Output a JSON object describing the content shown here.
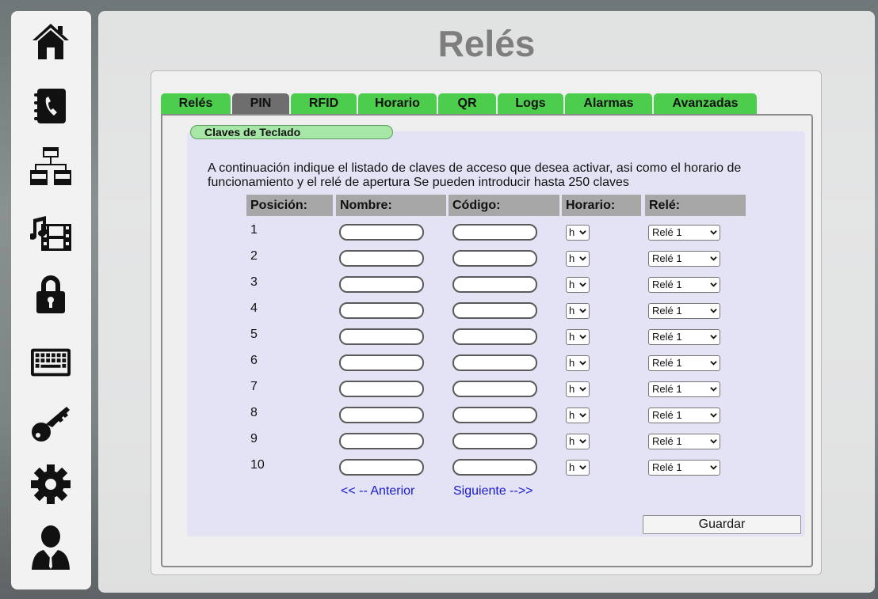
{
  "sidebar": {
    "items": [
      {
        "icon": "home-icon"
      },
      {
        "icon": "phonebook-icon"
      },
      {
        "icon": "network-icon"
      },
      {
        "icon": "multimedia-icon"
      },
      {
        "icon": "lock-icon"
      },
      {
        "icon": "keyboard-icon"
      },
      {
        "icon": "key-icon"
      },
      {
        "icon": "gear-icon"
      },
      {
        "icon": "user-icon"
      }
    ]
  },
  "page": {
    "title": "Relés"
  },
  "tabs": [
    {
      "label": "Relés",
      "active": false
    },
    {
      "label": "PIN",
      "active": true
    },
    {
      "label": "RFID",
      "active": false
    },
    {
      "label": "Horario",
      "active": false
    },
    {
      "label": "QR",
      "active": false
    },
    {
      "label": "Logs",
      "active": false
    },
    {
      "label": "Alarmas",
      "active": false
    },
    {
      "label": "Avanzadas",
      "active": false
    }
  ],
  "section": {
    "title": "Claves de Teclado",
    "description": "A continuación indique el listado de claves de acceso que desea activar, asi como el horario de funcionamiento y el relé de apertura Se pueden introducir hasta 250 claves"
  },
  "table": {
    "headers": [
      "Posición:",
      "Nombre:",
      "Código:",
      "Horario:",
      "Relé:"
    ],
    "rows": [
      {
        "pos": "1",
        "nombre": "",
        "codigo": "",
        "horario": "h",
        "rele": "Relé 1"
      },
      {
        "pos": "2",
        "nombre": "",
        "codigo": "",
        "horario": "h",
        "rele": "Relé 1"
      },
      {
        "pos": "3",
        "nombre": "",
        "codigo": "",
        "horario": "h",
        "rele": "Relé 1"
      },
      {
        "pos": "4",
        "nombre": "",
        "codigo": "",
        "horario": "h",
        "rele": "Relé 1"
      },
      {
        "pos": "5",
        "nombre": "",
        "codigo": "",
        "horario": "h",
        "rele": "Relé 1"
      },
      {
        "pos": "6",
        "nombre": "",
        "codigo": "",
        "horario": "h",
        "rele": "Relé 1"
      },
      {
        "pos": "7",
        "nombre": "",
        "codigo": "",
        "horario": "h",
        "rele": "Relé 1"
      },
      {
        "pos": "8",
        "nombre": "",
        "codigo": "",
        "horario": "h",
        "rele": "Relé 1"
      },
      {
        "pos": "9",
        "nombre": "",
        "codigo": "",
        "horario": "h",
        "rele": "Relé 1"
      },
      {
        "pos": "10",
        "nombre": "",
        "codigo": "",
        "horario": "h",
        "rele": "Relé 1"
      }
    ]
  },
  "pagination": {
    "prev": "<< -- Anterior",
    "next": "Siguiente -->>"
  },
  "actions": {
    "save": "Guardar"
  },
  "colors": {
    "tab": "#4ccd4c",
    "tab_active": "#6e6e6e",
    "pill": "#a6e6a6",
    "link": "#1a1acc"
  }
}
